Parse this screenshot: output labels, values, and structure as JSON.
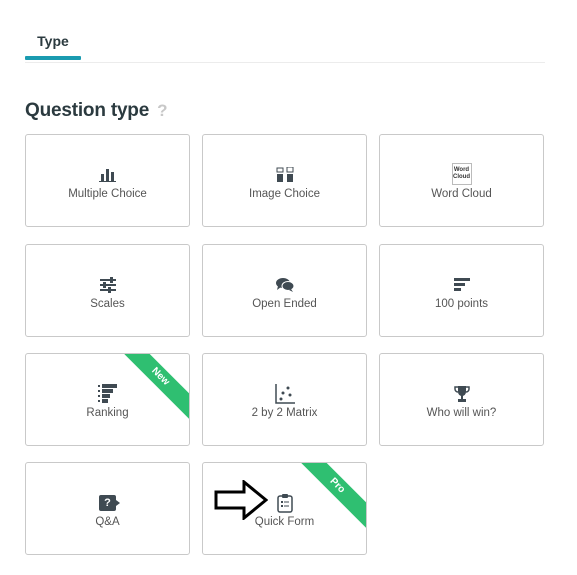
{
  "tabs": [
    {
      "label": "Type"
    }
  ],
  "section": {
    "title": "Question type",
    "help_icon": "?"
  },
  "cards": [
    {
      "label": "Multiple Choice",
      "icon": "bar-chart-icon"
    },
    {
      "label": "Image Choice",
      "icon": "image-choice-icon"
    },
    {
      "label": "Word Cloud",
      "icon": "word-cloud-icon",
      "icon_text": [
        "Word",
        "Cloud"
      ]
    },
    {
      "label": "Scales",
      "icon": "sliders-icon"
    },
    {
      "label": "Open Ended",
      "icon": "chat-bubbles-icon"
    },
    {
      "label": "100 points",
      "icon": "horizontal-bars-icon"
    },
    {
      "label": "Ranking",
      "icon": "ranking-icon",
      "badge": "New"
    },
    {
      "label": "2 by 2 Matrix",
      "icon": "scatter-matrix-icon"
    },
    {
      "label": "Who will win?",
      "icon": "trophy-icon"
    },
    {
      "label": "Q&A",
      "icon": "question-box-icon",
      "icon_text": "?"
    },
    {
      "label": "Quick Form",
      "icon": "clipboard-icon",
      "badge": "Pro"
    }
  ],
  "colors": {
    "accent": "#1a9bb0",
    "badge": "#2fbf71",
    "icon": "#3f4a52",
    "border": "#c9c9c9"
  }
}
